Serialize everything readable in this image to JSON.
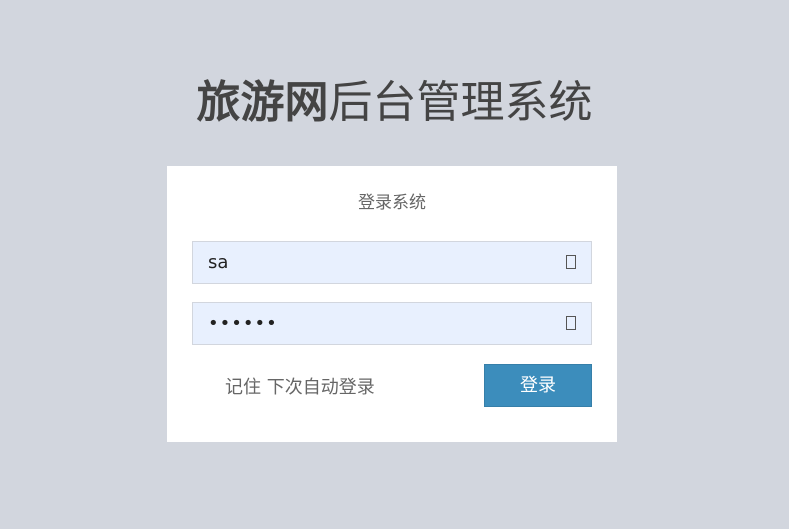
{
  "logo": {
    "bold_text": "旅游网",
    "light_text": "后台管理系统"
  },
  "login": {
    "message": "登录系统",
    "username_value": "sa",
    "password_value": "••••••",
    "username_icon": "envelope-icon",
    "password_icon": "lock-icon",
    "remember_label": "记住 下次自动登录",
    "submit_label": "登录"
  },
  "colors": {
    "background": "#d2d6de",
    "button": "#3c8dbc",
    "input_fill": "#e8f0fe"
  }
}
